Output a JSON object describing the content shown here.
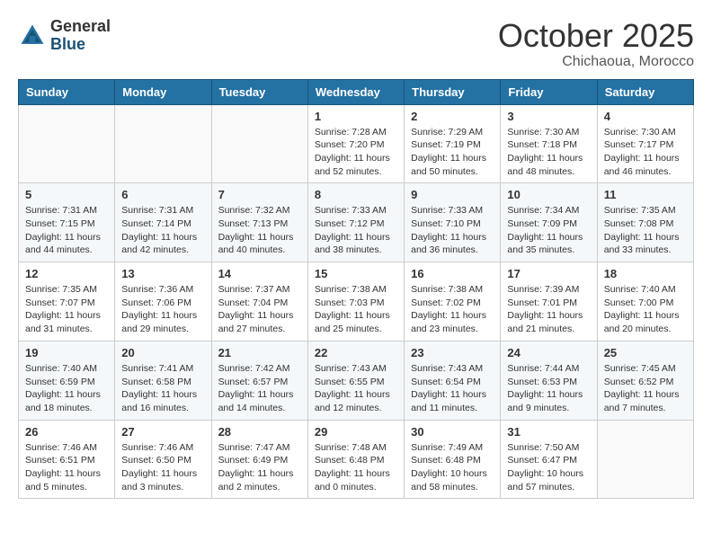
{
  "header": {
    "logo_line1": "General",
    "logo_line2": "Blue",
    "month": "October 2025",
    "location": "Chichaoua, Morocco"
  },
  "days_of_week": [
    "Sunday",
    "Monday",
    "Tuesday",
    "Wednesday",
    "Thursday",
    "Friday",
    "Saturday"
  ],
  "weeks": [
    [
      {
        "day": "",
        "info": ""
      },
      {
        "day": "",
        "info": ""
      },
      {
        "day": "",
        "info": ""
      },
      {
        "day": "1",
        "info": "Sunrise: 7:28 AM\nSunset: 7:20 PM\nDaylight: 11 hours and 52 minutes."
      },
      {
        "day": "2",
        "info": "Sunrise: 7:29 AM\nSunset: 7:19 PM\nDaylight: 11 hours and 50 minutes."
      },
      {
        "day": "3",
        "info": "Sunrise: 7:30 AM\nSunset: 7:18 PM\nDaylight: 11 hours and 48 minutes."
      },
      {
        "day": "4",
        "info": "Sunrise: 7:30 AM\nSunset: 7:17 PM\nDaylight: 11 hours and 46 minutes."
      }
    ],
    [
      {
        "day": "5",
        "info": "Sunrise: 7:31 AM\nSunset: 7:15 PM\nDaylight: 11 hours and 44 minutes."
      },
      {
        "day": "6",
        "info": "Sunrise: 7:31 AM\nSunset: 7:14 PM\nDaylight: 11 hours and 42 minutes."
      },
      {
        "day": "7",
        "info": "Sunrise: 7:32 AM\nSunset: 7:13 PM\nDaylight: 11 hours and 40 minutes."
      },
      {
        "day": "8",
        "info": "Sunrise: 7:33 AM\nSunset: 7:12 PM\nDaylight: 11 hours and 38 minutes."
      },
      {
        "day": "9",
        "info": "Sunrise: 7:33 AM\nSunset: 7:10 PM\nDaylight: 11 hours and 36 minutes."
      },
      {
        "day": "10",
        "info": "Sunrise: 7:34 AM\nSunset: 7:09 PM\nDaylight: 11 hours and 35 minutes."
      },
      {
        "day": "11",
        "info": "Sunrise: 7:35 AM\nSunset: 7:08 PM\nDaylight: 11 hours and 33 minutes."
      }
    ],
    [
      {
        "day": "12",
        "info": "Sunrise: 7:35 AM\nSunset: 7:07 PM\nDaylight: 11 hours and 31 minutes."
      },
      {
        "day": "13",
        "info": "Sunrise: 7:36 AM\nSunset: 7:06 PM\nDaylight: 11 hours and 29 minutes."
      },
      {
        "day": "14",
        "info": "Sunrise: 7:37 AM\nSunset: 7:04 PM\nDaylight: 11 hours and 27 minutes."
      },
      {
        "day": "15",
        "info": "Sunrise: 7:38 AM\nSunset: 7:03 PM\nDaylight: 11 hours and 25 minutes."
      },
      {
        "day": "16",
        "info": "Sunrise: 7:38 AM\nSunset: 7:02 PM\nDaylight: 11 hours and 23 minutes."
      },
      {
        "day": "17",
        "info": "Sunrise: 7:39 AM\nSunset: 7:01 PM\nDaylight: 11 hours and 21 minutes."
      },
      {
        "day": "18",
        "info": "Sunrise: 7:40 AM\nSunset: 7:00 PM\nDaylight: 11 hours and 20 minutes."
      }
    ],
    [
      {
        "day": "19",
        "info": "Sunrise: 7:40 AM\nSunset: 6:59 PM\nDaylight: 11 hours and 18 minutes."
      },
      {
        "day": "20",
        "info": "Sunrise: 7:41 AM\nSunset: 6:58 PM\nDaylight: 11 hours and 16 minutes."
      },
      {
        "day": "21",
        "info": "Sunrise: 7:42 AM\nSunset: 6:57 PM\nDaylight: 11 hours and 14 minutes."
      },
      {
        "day": "22",
        "info": "Sunrise: 7:43 AM\nSunset: 6:55 PM\nDaylight: 11 hours and 12 minutes."
      },
      {
        "day": "23",
        "info": "Sunrise: 7:43 AM\nSunset: 6:54 PM\nDaylight: 11 hours and 11 minutes."
      },
      {
        "day": "24",
        "info": "Sunrise: 7:44 AM\nSunset: 6:53 PM\nDaylight: 11 hours and 9 minutes."
      },
      {
        "day": "25",
        "info": "Sunrise: 7:45 AM\nSunset: 6:52 PM\nDaylight: 11 hours and 7 minutes."
      }
    ],
    [
      {
        "day": "26",
        "info": "Sunrise: 7:46 AM\nSunset: 6:51 PM\nDaylight: 11 hours and 5 minutes."
      },
      {
        "day": "27",
        "info": "Sunrise: 7:46 AM\nSunset: 6:50 PM\nDaylight: 11 hours and 3 minutes."
      },
      {
        "day": "28",
        "info": "Sunrise: 7:47 AM\nSunset: 6:49 PM\nDaylight: 11 hours and 2 minutes."
      },
      {
        "day": "29",
        "info": "Sunrise: 7:48 AM\nSunset: 6:48 PM\nDaylight: 11 hours and 0 minutes."
      },
      {
        "day": "30",
        "info": "Sunrise: 7:49 AM\nSunset: 6:48 PM\nDaylight: 10 hours and 58 minutes."
      },
      {
        "day": "31",
        "info": "Sunrise: 7:50 AM\nSunset: 6:47 PM\nDaylight: 10 hours and 57 minutes."
      },
      {
        "day": "",
        "info": ""
      }
    ]
  ]
}
